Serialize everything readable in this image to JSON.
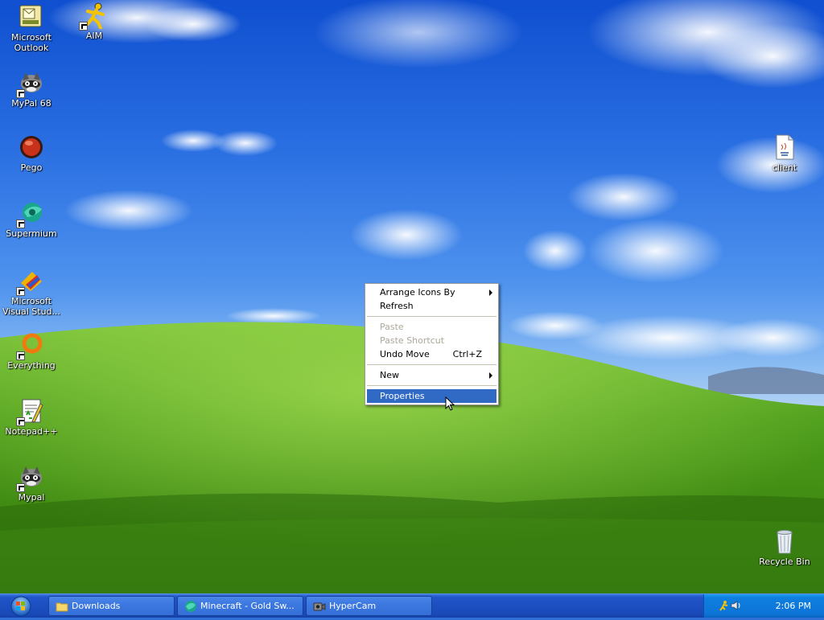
{
  "desktop": {
    "icons": [
      {
        "id": "outlook",
        "label": "Microsoft Outlook"
      },
      {
        "id": "aim",
        "label": "AIM"
      },
      {
        "id": "mypal68",
        "label": "MyPal 68"
      },
      {
        "id": "pego",
        "label": "Pego"
      },
      {
        "id": "supermium",
        "label": "Supermium"
      },
      {
        "id": "msvs",
        "label": "Microsoft Visual Stud..."
      },
      {
        "id": "everything",
        "label": "Everything"
      },
      {
        "id": "notepadpp",
        "label": "Notepad++"
      },
      {
        "id": "mypal",
        "label": "Mypal"
      },
      {
        "id": "client",
        "label": "client"
      },
      {
        "id": "recycle",
        "label": "Recycle Bin"
      }
    ]
  },
  "context_menu": {
    "arrange_icons_by": "Arrange Icons By",
    "refresh": "Refresh",
    "paste": "Paste",
    "paste_shortcut": "Paste Shortcut",
    "undo_move": "Undo Move",
    "undo_move_shortcut": "Ctrl+Z",
    "new": "New",
    "properties": "Properties"
  },
  "taskbar": {
    "buttons": [
      {
        "label": "Downloads",
        "icon": "folder-icon"
      },
      {
        "label": "Minecraft - Gold Sw...",
        "icon": "supermium-icon"
      },
      {
        "label": "HyperCam",
        "icon": "hypercam-icon"
      }
    ],
    "clock": "2:06 PM"
  },
  "colors": {
    "menu_highlight": "#316ac5",
    "taskbar": "#1c4fc0",
    "tray": "#0d74d6"
  }
}
